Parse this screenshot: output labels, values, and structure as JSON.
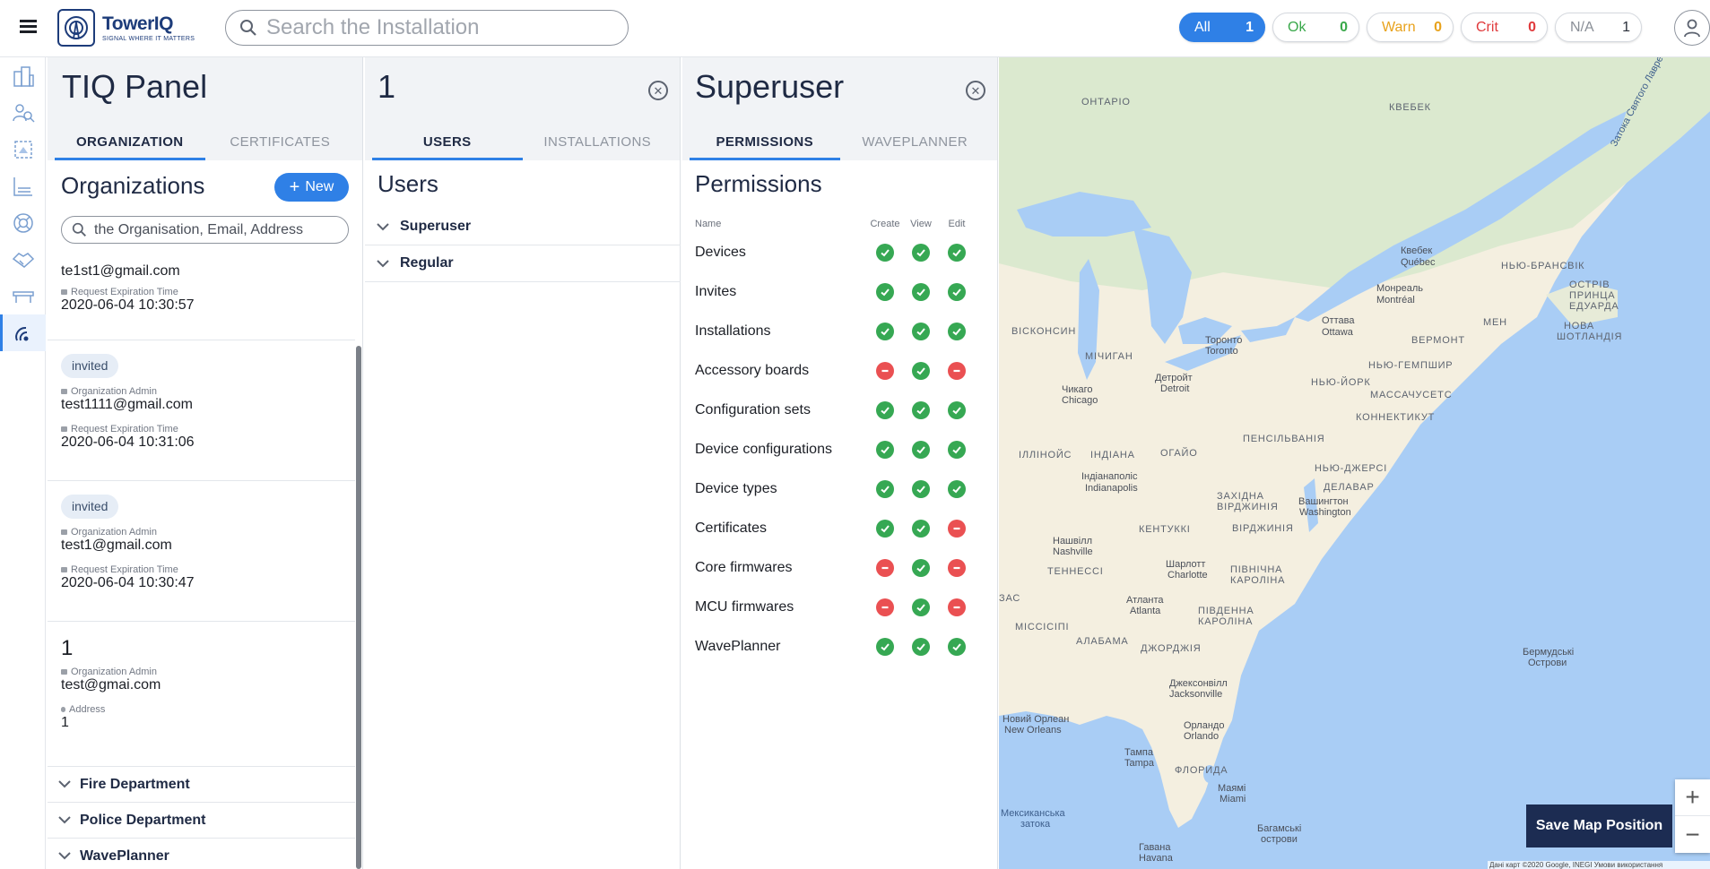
{
  "header": {
    "logo_name": "TowerIQ",
    "logo_tagline": "SIGNAL WHERE IT MATTERS",
    "search_placeholder": "Search the Installation",
    "filters": [
      {
        "label": "All",
        "count": "1"
      },
      {
        "label": "Ok",
        "count": "0"
      },
      {
        "label": "Warn",
        "count": "0"
      },
      {
        "label": "Crit",
        "count": "0"
      },
      {
        "label": "N/A",
        "count": "1"
      }
    ],
    "colors": {
      "accent": "#2f80e6",
      "ok": "#39a84a",
      "warn": "#e8a21c",
      "crit": "#e0393b"
    }
  },
  "rail": {
    "icons": [
      "buildings-icon",
      "inspect-person-icon",
      "installation-icon",
      "floorplan-icon",
      "support-icon",
      "handshake-icon",
      "bench-icon",
      "signal-icon"
    ],
    "active": "signal-icon"
  },
  "panel1": {
    "title": "TIQ Panel",
    "tabs": [
      "ORGANIZATION",
      "CERTIFICATES"
    ],
    "section_title": "Organizations",
    "new_label": "New",
    "search_placeholder": "the Organisation, Email, Address",
    "cards": [
      {
        "email": "te1st1@gmail.com",
        "exp_label": "Request Expiration Time",
        "exp_value": "2020-06-04 10:30:57"
      },
      {
        "badge": "invited",
        "role_label": "Organization Admin",
        "email": "test1111@gmail.com",
        "exp_label": "Request Expiration Time",
        "exp_value": "2020-06-04 10:31:06"
      },
      {
        "badge": "invited",
        "role_label": "Organization Admin",
        "email": "test1@gmail.com",
        "exp_label": "Request Expiration Time",
        "exp_value": "2020-06-04 10:30:47"
      },
      {
        "name": "1",
        "role_label": "Organization Admin",
        "email": "test@gmai.com",
        "addr_label": "Address",
        "addr_value": "1"
      }
    ],
    "groups": [
      "Fire Department",
      "Police Department",
      "WavePlanner"
    ]
  },
  "panel2": {
    "title": "1",
    "tabs": [
      "USERS",
      "INSTALLATIONS"
    ],
    "section_title": "Users",
    "groups": [
      "Superuser",
      "Regular"
    ]
  },
  "panel3": {
    "title": "Superuser",
    "tabs": [
      "PERMISSIONS",
      "WAVEPLANNER"
    ],
    "section_title": "Permissions",
    "columns": [
      "Name",
      "Create",
      "View",
      "Edit"
    ],
    "rows": [
      {
        "name": "Devices",
        "create": true,
        "view": true,
        "edit": true
      },
      {
        "name": "Invites",
        "create": true,
        "view": true,
        "edit": true
      },
      {
        "name": "Installations",
        "create": true,
        "view": true,
        "edit": true
      },
      {
        "name": "Accessory boards",
        "create": false,
        "view": true,
        "edit": false
      },
      {
        "name": "Configuration sets",
        "create": true,
        "view": true,
        "edit": true
      },
      {
        "name": "Device configurations",
        "create": true,
        "view": true,
        "edit": true
      },
      {
        "name": "Device types",
        "create": true,
        "view": true,
        "edit": true
      },
      {
        "name": "Certificates",
        "create": true,
        "view": true,
        "edit": false
      },
      {
        "name": "Core firmwares",
        "create": false,
        "view": true,
        "edit": false
      },
      {
        "name": "MCU firmwares",
        "create": false,
        "view": true,
        "edit": false
      },
      {
        "name": "WavePlanner",
        "create": true,
        "view": true,
        "edit": true
      }
    ]
  },
  "map": {
    "labels": {
      "ontario": "ОНТАРІО",
      "quebec_prov": "КВЕБЕК",
      "quebec_city": "Квебек",
      "quebec_city_fr": "Québec",
      "montreal": "Монреаль",
      "montreal_fr": "Montréal",
      "ottawa": "Оттава",
      "ottawa_fr": "Ottawa",
      "nb": "НЬЮ-БРАНСВІК",
      "pei1": "ОСТРІВ",
      "pei2": "ПРИНЦА",
      "pei3": "ЕДУАРДА",
      "maine": "МЕН",
      "vermont": "ВЕРМОНТ",
      "nh": "НЬЮ-ГЕМПШИР",
      "ns1": "НОВА",
      "ns2": "ШОТЛАНДІЯ",
      "wisconsin": "ВІСКОНСИН",
      "michigan": "МІЧИГАН",
      "toronto": "Торонто",
      "toronto_en": "Toronto",
      "detroit": "Детройт",
      "detroit_en": "Detroit",
      "chicago": "Чикаго",
      "chicago_en": "Chicago",
      "ny": "НЬЮ-ЙОРК",
      "mass": "МАССАЧУСЕТС",
      "conn": "КОННЕКТИКУТ",
      "illinois": "ІЛЛІНОЙС",
      "indiana": "ІНДІАНА",
      "ohio": "ОГАЙО",
      "penn": "ПЕНСІЛЬВАНІЯ",
      "indy": "Індіанаполіс",
      "indy_en": "Indianapolis",
      "nj": "НЬЮ-ДЖЕРСІ",
      "delaware": "ДЕЛАВАР",
      "wv1": "ЗАХІДНА",
      "wv2": "ВІРДЖИНІЯ",
      "washington": "Вашингтон",
      "washington_en": "Washington",
      "kentucky": "КЕНТУККІ",
      "virginia": "ВІРДЖИНІЯ",
      "nashville": "Нашвілл",
      "nashville_en": "Nashville",
      "tennessee": "ТЕННЕССІ",
      "charlotte": "Шарлотт",
      "charlotte_en": "Charlotte",
      "nc1": "ПІВНІЧНА",
      "nc2": "КАРОЛІНА",
      "atlanta": "Атланта",
      "atlanta_en": "Atlanta",
      "sc1": "ПІВДЕННА",
      "sc2": "КАРОЛІНА",
      "mississippi": "МІССІСІПІ",
      "alabama": "АЛАБАМА",
      "georgia": "ДЖОРДЖІЯ",
      "jax": "Джексонвілл",
      "jax_en": "Jacksonville",
      "nola": "Новий Орлеан",
      "nola_en": "New Orleans",
      "orlando": "Орландо",
      "orlando_en": "Orlando",
      "tampa": "Тампа",
      "tampa_en": "Tampa",
      "florida": "ФЛОРИДА",
      "miami": "Маямі",
      "miami_en": "Miami",
      "bermuda1": "Бермудські",
      "bermuda2": "Острови",
      "gulf1": "Мексиканська",
      "gulf2": "затока",
      "bahamas1": "Багамські",
      "bahamas2": "острови",
      "havana": "Гавана",
      "havana_en": "Havana",
      "kansas": "ЗАС",
      "gulf_stl": "Затока Святого Лаврентія"
    },
    "save_label": "Save Map Position",
    "zoom_in": "+",
    "zoom_out": "−",
    "footer": "Дані карт ©2020 Google, INEGI   Умови використання"
  }
}
